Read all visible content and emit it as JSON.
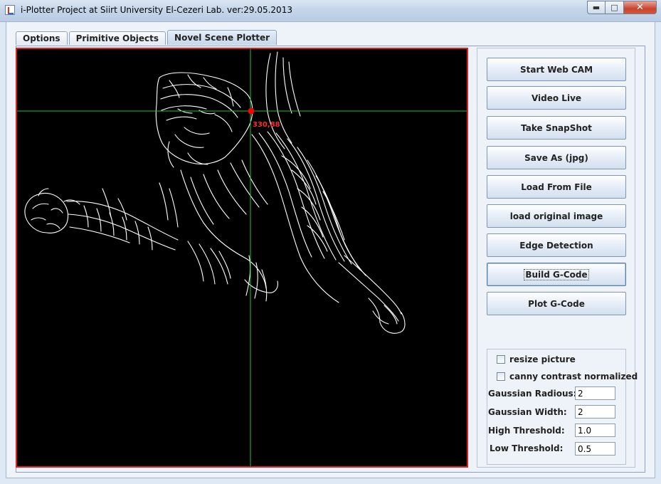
{
  "window": {
    "title": "i-Plotter Project at Siirt University El-Cezeri Lab.  ver:29.05.2013",
    "minimize_icon": "minimize-icon",
    "maximize_icon": "maximize-icon",
    "close_icon": "close-icon",
    "minimize_glyph": "▬",
    "maximize_glyph": "□",
    "close_glyph": "✕"
  },
  "tabs": [
    {
      "label": "Options",
      "active": false
    },
    {
      "label": "Primitive Objects",
      "active": false
    },
    {
      "label": "Novel Scene Plotter",
      "active": true
    }
  ],
  "canvas": {
    "image": "tiger edge-detection image",
    "crosshair_color": "#19c23a",
    "marker_color": "#ff0000",
    "coordinate_label": "330,88"
  },
  "buttons": [
    {
      "label": "Start Web CAM"
    },
    {
      "label": "Video Live"
    },
    {
      "label": "Take SnapShot"
    },
    {
      "label": "Save As (jpg)"
    },
    {
      "label": "Load From File"
    },
    {
      "label": "load original image"
    },
    {
      "label": "Edge Detection"
    },
    {
      "label": "Build G-Code",
      "focused": true
    },
    {
      "label": "Plot G-Code"
    }
  ],
  "options": {
    "resize_picture": {
      "label": "resize picture",
      "checked": false
    },
    "canny_contrast": {
      "label": "canny contrast normalized",
      "checked": false
    },
    "gaussian_radius": {
      "label": "Gaussian Radious:",
      "value": "2"
    },
    "gaussian_width": {
      "label": "Gaussian Width:",
      "value": "2"
    },
    "high_threshold": {
      "label": "High Threshold:",
      "value": "1.0"
    },
    "low_threshold": {
      "label": "Low Threshold:",
      "value": "0.5"
    }
  },
  "colors": {
    "canvas_border": "#e01f1f",
    "canvas_background": "#000000"
  }
}
